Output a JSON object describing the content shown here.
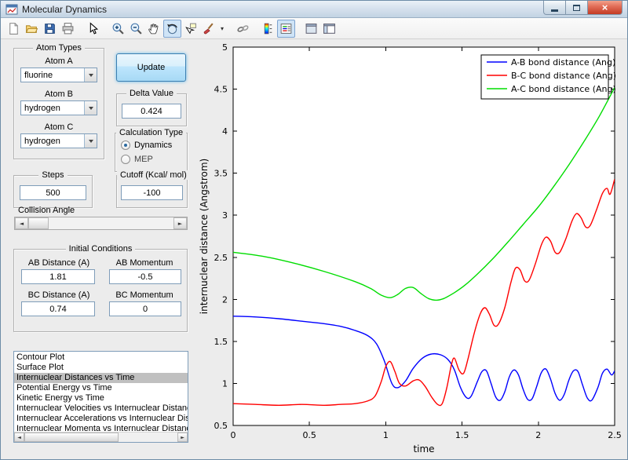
{
  "window": {
    "title": "Molecular Dynamics",
    "close_glyph": "×"
  },
  "glyphs": {
    "arrow_left": "◄",
    "arrow_right": "►",
    "dropdown": "▾"
  },
  "toolbar": {
    "buttons": [
      "new-figure",
      "open-file",
      "save-figure",
      "print-figure",
      "edit-plot",
      "zoom-in",
      "zoom-out",
      "pan",
      "rotate-3d",
      "data-cursor",
      "brush-data",
      "brush-dropdown",
      "link-plot",
      "insert-colorbar",
      "insert-legend",
      "hide-plot-tools",
      "show-plot-tools"
    ]
  },
  "left_panel": {
    "atom_types": {
      "title": "Atom Types",
      "atom_a_label": "Atom A",
      "atom_a_value": "fluorine",
      "atom_b_label": "Atom B",
      "atom_b_value": "hydrogen",
      "atom_c_label": "Atom C",
      "atom_c_value": "hydrogen"
    },
    "update_button_label": "Update",
    "delta": {
      "title": "Delta Value",
      "value": "0.424"
    },
    "calculation_type": {
      "title": "Calculation Type",
      "dynamics_label": "Dynamics",
      "mep_label": "MEP",
      "selected": "Dynamics"
    },
    "steps": {
      "title": "Steps",
      "value": "500"
    },
    "cutoff": {
      "title": "Cutoff (Kcal/ mol)",
      "value": "-100"
    },
    "collision_angle_label": "Collision Angle",
    "initial_conditions": {
      "title": "Initial Conditions",
      "ab_distance_label": "AB Distance (A)",
      "ab_distance_value": "1.81",
      "ab_momentum_label": "AB Momentum",
      "ab_momentum_value": "-0.5",
      "bc_distance_label": "BC Distance (A)",
      "bc_distance_value": "0.74",
      "bc_momentum_label": "BC Momentum",
      "bc_momentum_value": "0"
    },
    "plot_list": {
      "items": [
        "Contour Plot",
        "Surface Plot",
        "Internuclear Distances vs Time",
        "Potential Energy vs Time",
        "Kinetic Energy vs Time",
        "Internuclear Velocities vs Internuclear Distance",
        "Internuclear Accelerations vs Internuclear Distance",
        "Internuclear Momenta vs Internuclear Distance"
      ],
      "selected_index": 2
    }
  },
  "chart_data": {
    "type": "line",
    "xlabel": "time",
    "ylabel": "internuclear distance (Angstrom)",
    "xlim": [
      0,
      2.5
    ],
    "ylim": [
      0.5,
      5
    ],
    "xticks": [
      0,
      0.5,
      1,
      1.5,
      2,
      2.5
    ],
    "yticks": [
      0.5,
      1,
      1.5,
      2,
      2.5,
      3,
      3.5,
      4,
      4.5,
      5
    ],
    "xtick_labels": [
      "0",
      "0.5",
      "1",
      "1.5",
      "2",
      "2.5"
    ],
    "ytick_labels": [
      "0.5",
      "1",
      "1.5",
      "2",
      "2.5",
      "3",
      "3.5",
      "4",
      "4.5",
      "5"
    ],
    "grid": false,
    "legend_position": "top-right",
    "series": [
      {
        "name": "A-B bond distance (Ang)",
        "color": "#0000ff",
        "points": [
          [
            0,
            1.8
          ],
          [
            0.15,
            1.79
          ],
          [
            0.3,
            1.77
          ],
          [
            0.45,
            1.74
          ],
          [
            0.6,
            1.71
          ],
          [
            0.7,
            1.68
          ],
          [
            0.8,
            1.63
          ],
          [
            0.88,
            1.57
          ],
          [
            0.94,
            1.47
          ],
          [
            0.99,
            1.27
          ],
          [
            1.04,
            1.0
          ],
          [
            1.08,
            0.95
          ],
          [
            1.13,
            1.03
          ],
          [
            1.18,
            1.18
          ],
          [
            1.24,
            1.3
          ],
          [
            1.3,
            1.35
          ],
          [
            1.36,
            1.34
          ],
          [
            1.41,
            1.28
          ],
          [
            1.45,
            1.16
          ],
          [
            1.49,
            0.95
          ],
          [
            1.53,
            0.83
          ],
          [
            1.56,
            0.85
          ],
          [
            1.6,
            1.02
          ],
          [
            1.63,
            1.14
          ],
          [
            1.66,
            1.15
          ],
          [
            1.69,
            1.0
          ],
          [
            1.72,
            0.84
          ],
          [
            1.75,
            0.8
          ],
          [
            1.78,
            0.9
          ],
          [
            1.81,
            1.08
          ],
          [
            1.84,
            1.16
          ],
          [
            1.87,
            1.1
          ],
          [
            1.9,
            0.93
          ],
          [
            1.93,
            0.81
          ],
          [
            1.96,
            0.82
          ],
          [
            1.99,
            0.97
          ],
          [
            2.02,
            1.13
          ],
          [
            2.05,
            1.17
          ],
          [
            2.08,
            1.05
          ],
          [
            2.11,
            0.88
          ],
          [
            2.14,
            0.8
          ],
          [
            2.17,
            0.87
          ],
          [
            2.2,
            1.04
          ],
          [
            2.23,
            1.15
          ],
          [
            2.26,
            1.14
          ],
          [
            2.29,
            0.98
          ],
          [
            2.32,
            0.83
          ],
          [
            2.35,
            0.8
          ],
          [
            2.39,
            0.95
          ],
          [
            2.42,
            1.12
          ],
          [
            2.45,
            1.17
          ],
          [
            2.48,
            1.1
          ],
          [
            2.5,
            1.15
          ]
        ]
      },
      {
        "name": "B-C bond distance (Ang)",
        "color": "#ff0000",
        "points": [
          [
            0,
            0.76
          ],
          [
            0.15,
            0.75
          ],
          [
            0.3,
            0.74
          ],
          [
            0.45,
            0.75
          ],
          [
            0.6,
            0.74
          ],
          [
            0.7,
            0.75
          ],
          [
            0.8,
            0.76
          ],
          [
            0.88,
            0.79
          ],
          [
            0.93,
            0.85
          ],
          [
            0.97,
            1.02
          ],
          [
            1.0,
            1.2
          ],
          [
            1.03,
            1.26
          ],
          [
            1.06,
            1.14
          ],
          [
            1.09,
            1.0
          ],
          [
            1.13,
            0.97
          ],
          [
            1.18,
            1.03
          ],
          [
            1.22,
            1.04
          ],
          [
            1.26,
            0.96
          ],
          [
            1.3,
            0.84
          ],
          [
            1.34,
            0.75
          ],
          [
            1.37,
            0.76
          ],
          [
            1.4,
            0.95
          ],
          [
            1.43,
            1.22
          ],
          [
            1.45,
            1.3
          ],
          [
            1.48,
            1.16
          ],
          [
            1.51,
            1.12
          ],
          [
            1.54,
            1.3
          ],
          [
            1.58,
            1.6
          ],
          [
            1.62,
            1.83
          ],
          [
            1.65,
            1.9
          ],
          [
            1.68,
            1.82
          ],
          [
            1.71,
            1.69
          ],
          [
            1.74,
            1.71
          ],
          [
            1.78,
            1.9
          ],
          [
            1.82,
            2.2
          ],
          [
            1.85,
            2.37
          ],
          [
            1.88,
            2.35
          ],
          [
            1.91,
            2.22
          ],
          [
            1.94,
            2.23
          ],
          [
            1.98,
            2.42
          ],
          [
            2.02,
            2.65
          ],
          [
            2.05,
            2.74
          ],
          [
            2.08,
            2.69
          ],
          [
            2.11,
            2.56
          ],
          [
            2.14,
            2.56
          ],
          [
            2.18,
            2.72
          ],
          [
            2.22,
            2.93
          ],
          [
            2.25,
            3.02
          ],
          [
            2.28,
            2.97
          ],
          [
            2.31,
            2.86
          ],
          [
            2.34,
            2.88
          ],
          [
            2.38,
            3.06
          ],
          [
            2.42,
            3.26
          ],
          [
            2.45,
            3.32
          ],
          [
            2.47,
            3.25
          ],
          [
            2.5,
            3.43
          ]
        ]
      },
      {
        "name": "A-C bond distance (Ang)",
        "color": "#00dd00",
        "points": [
          [
            0,
            2.56
          ],
          [
            0.2,
            2.51
          ],
          [
            0.4,
            2.43
          ],
          [
            0.6,
            2.33
          ],
          [
            0.8,
            2.21
          ],
          [
            0.9,
            2.13
          ],
          [
            0.97,
            2.05
          ],
          [
            1.03,
            2.02
          ],
          [
            1.08,
            2.06
          ],
          [
            1.13,
            2.13
          ],
          [
            1.18,
            2.14
          ],
          [
            1.23,
            2.07
          ],
          [
            1.28,
            2.01
          ],
          [
            1.33,
            1.99
          ],
          [
            1.38,
            2.01
          ],
          [
            1.45,
            2.08
          ],
          [
            1.52,
            2.17
          ],
          [
            1.6,
            2.3
          ],
          [
            1.7,
            2.48
          ],
          [
            1.8,
            2.68
          ],
          [
            1.9,
            2.89
          ],
          [
            2.0,
            3.1
          ],
          [
            2.1,
            3.34
          ],
          [
            2.2,
            3.6
          ],
          [
            2.3,
            3.88
          ],
          [
            2.4,
            4.18
          ],
          [
            2.5,
            4.52
          ]
        ]
      }
    ]
  }
}
